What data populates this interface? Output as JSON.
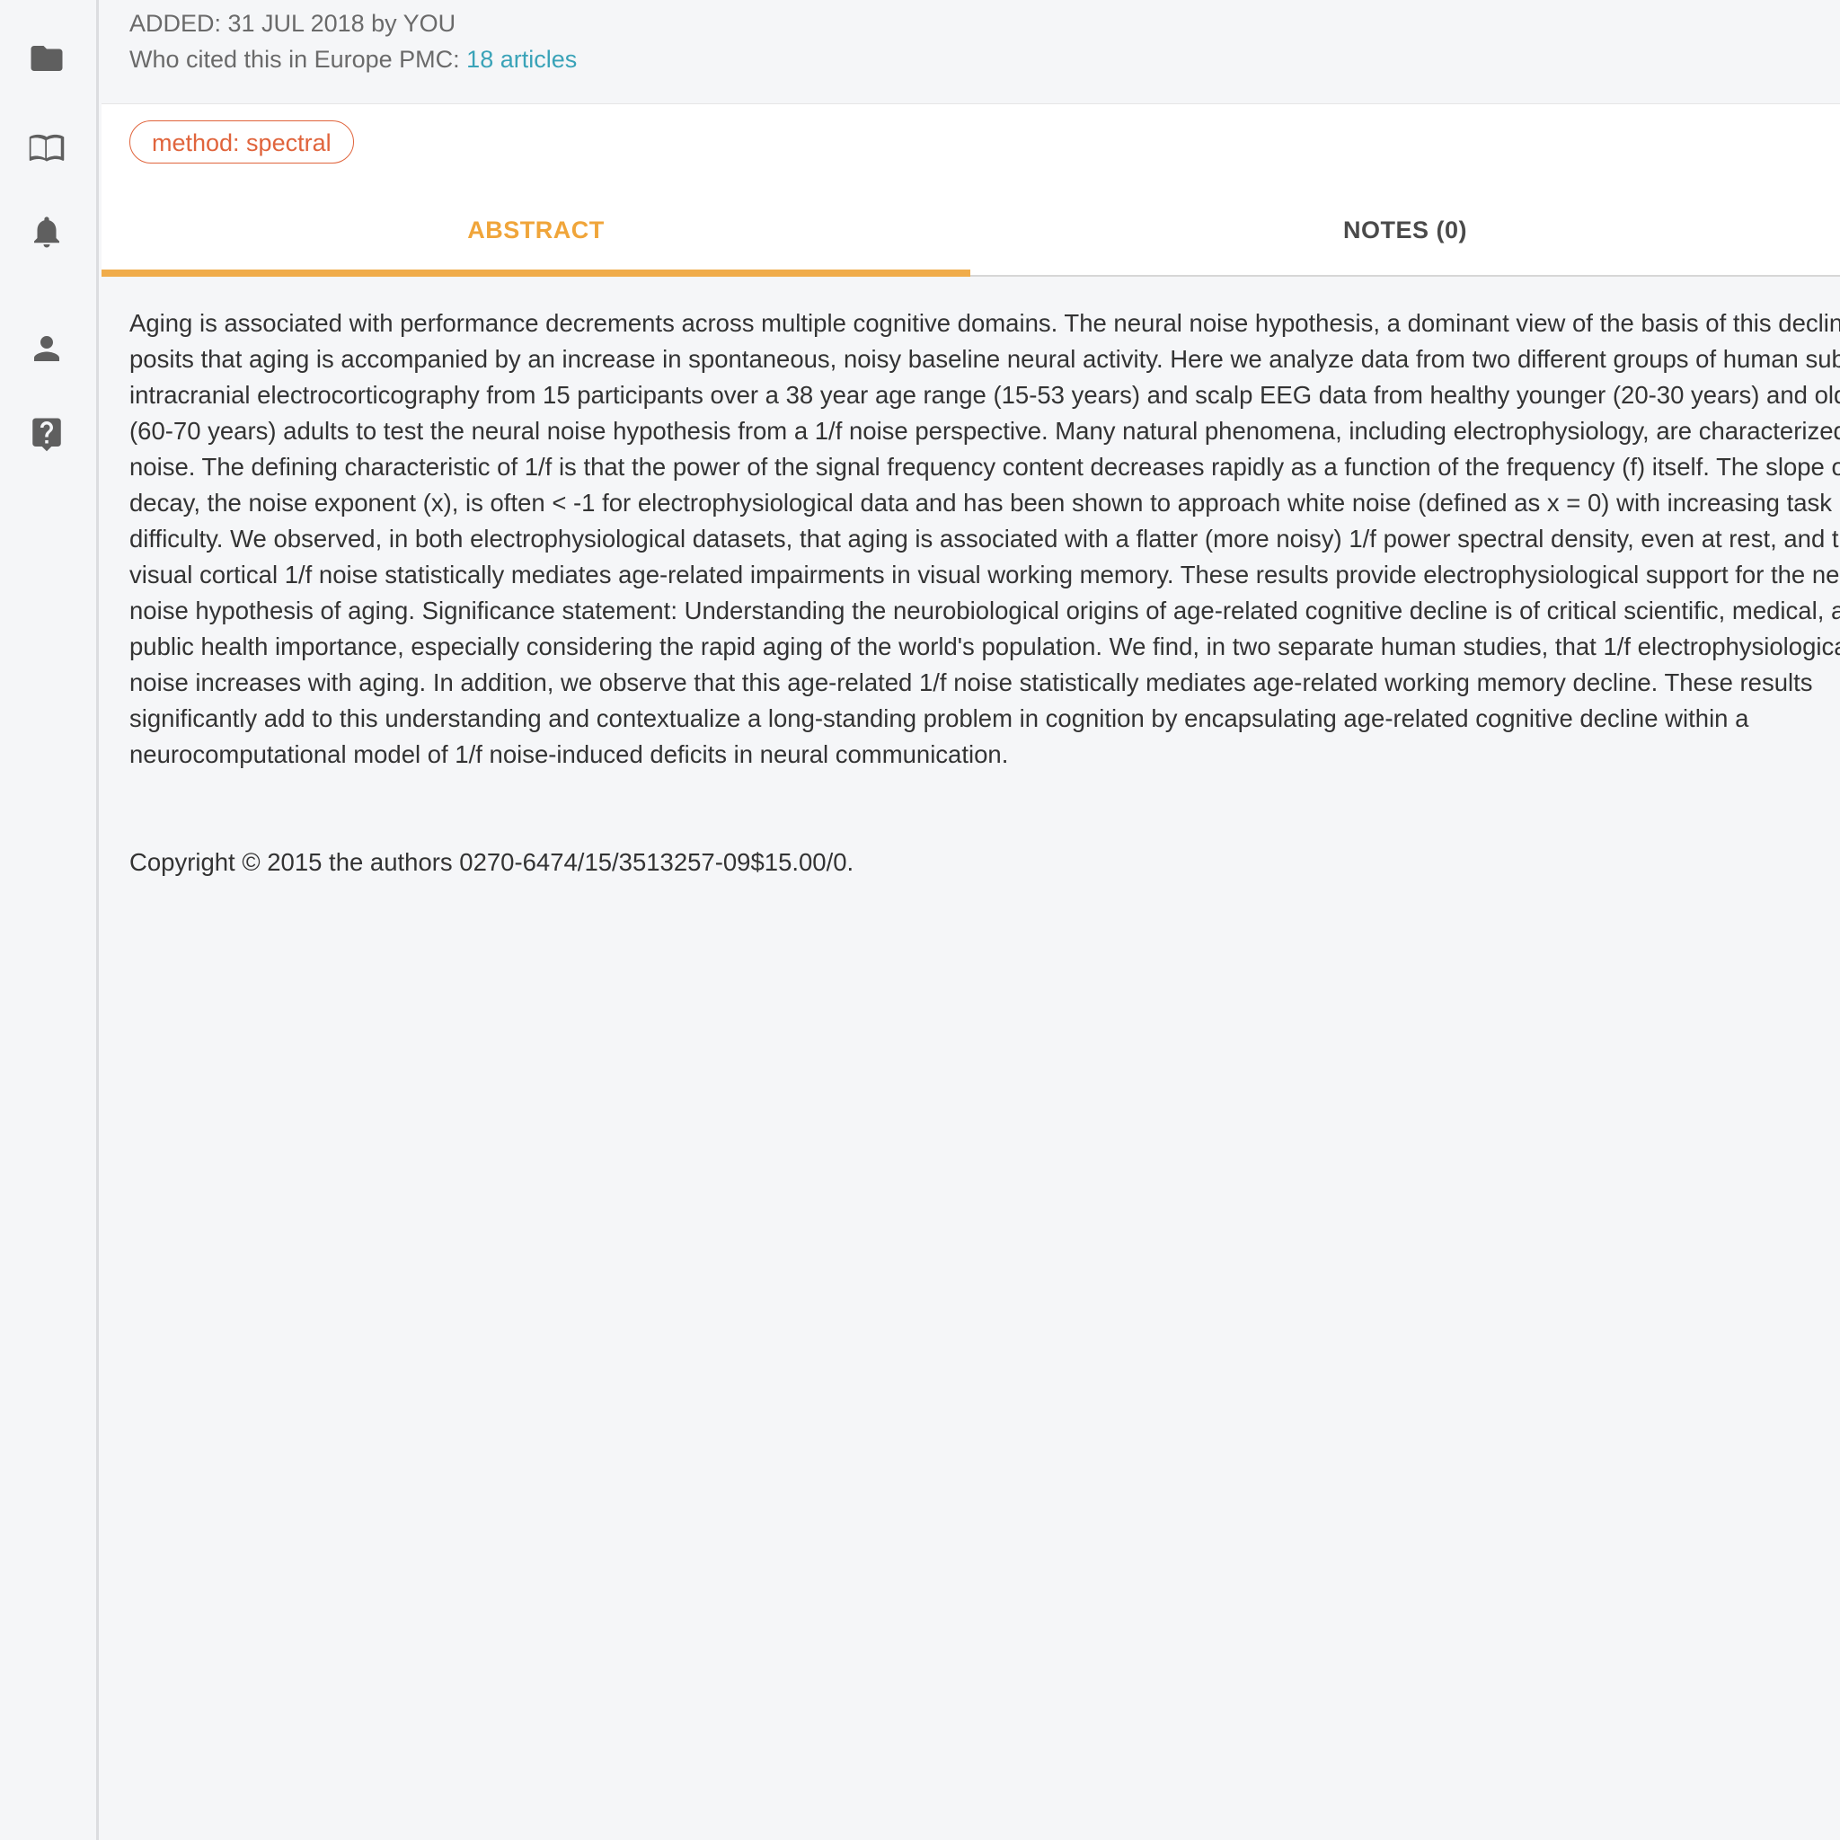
{
  "sidebar": {
    "icons": [
      {
        "name": "folder-icon"
      },
      {
        "name": "book-icon"
      },
      {
        "name": "bell-icon"
      },
      {
        "name": "person-icon"
      },
      {
        "name": "help-icon"
      }
    ]
  },
  "meta": {
    "added": "ADDED: 31 JUL 2018 by YOU",
    "cited_prefix": "Who cited this in Europe PMC:",
    "cited_link": "18 articles"
  },
  "tags": [
    "method: spectral"
  ],
  "tabs": {
    "abstract": "ABSTRACT",
    "notes": "NOTES (0)"
  },
  "abstract_text": "Aging is associated with performance decrements across multiple cognitive domains. The neural noise hypothesis, a dominant view of the basis of this decline, posits that aging is accompanied by an increase in spontaneous, noisy baseline neural activity. Here we analyze data from two different groups of human subjects: intracranial electrocorticography from 15 participants over a 38 year age range (15-53 years) and scalp EEG data from healthy younger (20-30 years) and older (60-70 years) adults to test the neural noise hypothesis from a 1/f noise perspective. Many natural phenomena, including electrophysiology, are characterized by 1/f noise. The defining characteristic of 1/f is that the power of the signal frequency content decreases rapidly as a function of the frequency (f) itself. The slope of this decay, the noise exponent (x), is often < -1 for electrophysiological data and has been shown to approach white noise (defined as x = 0) with increasing task difficulty. We observed, in both electrophysiological datasets, that aging is associated with a flatter (more noisy) 1/f power spectral density, even at rest, and that visual cortical 1/f noise statistically mediates age-related impairments in visual working memory. These results provide electrophysiological support for the neural noise hypothesis of aging. Significance statement: Understanding the neurobiological origins of age-related cognitive decline is of critical scientific, medical, and public health importance, especially considering the rapid aging of the world's population. We find, in two separate human studies, that 1/f electrophysiological noise increases with aging. In addition, we observe that this age-related 1/f noise statistically mediates age-related working memory decline. These results significantly add to this understanding and contextualize a long-standing problem in cognition by encapsulating age-related cognitive decline within a neurocomputational model of 1/f noise-induced deficits in neural communication.",
  "copyright": "Copyright © 2015 the authors 0270-6474/15/3513257-09$15.00/0.",
  "colors": {
    "accent_tab": "#f0ac4a",
    "tag": "#e0643c",
    "link": "#3aa3b8"
  }
}
